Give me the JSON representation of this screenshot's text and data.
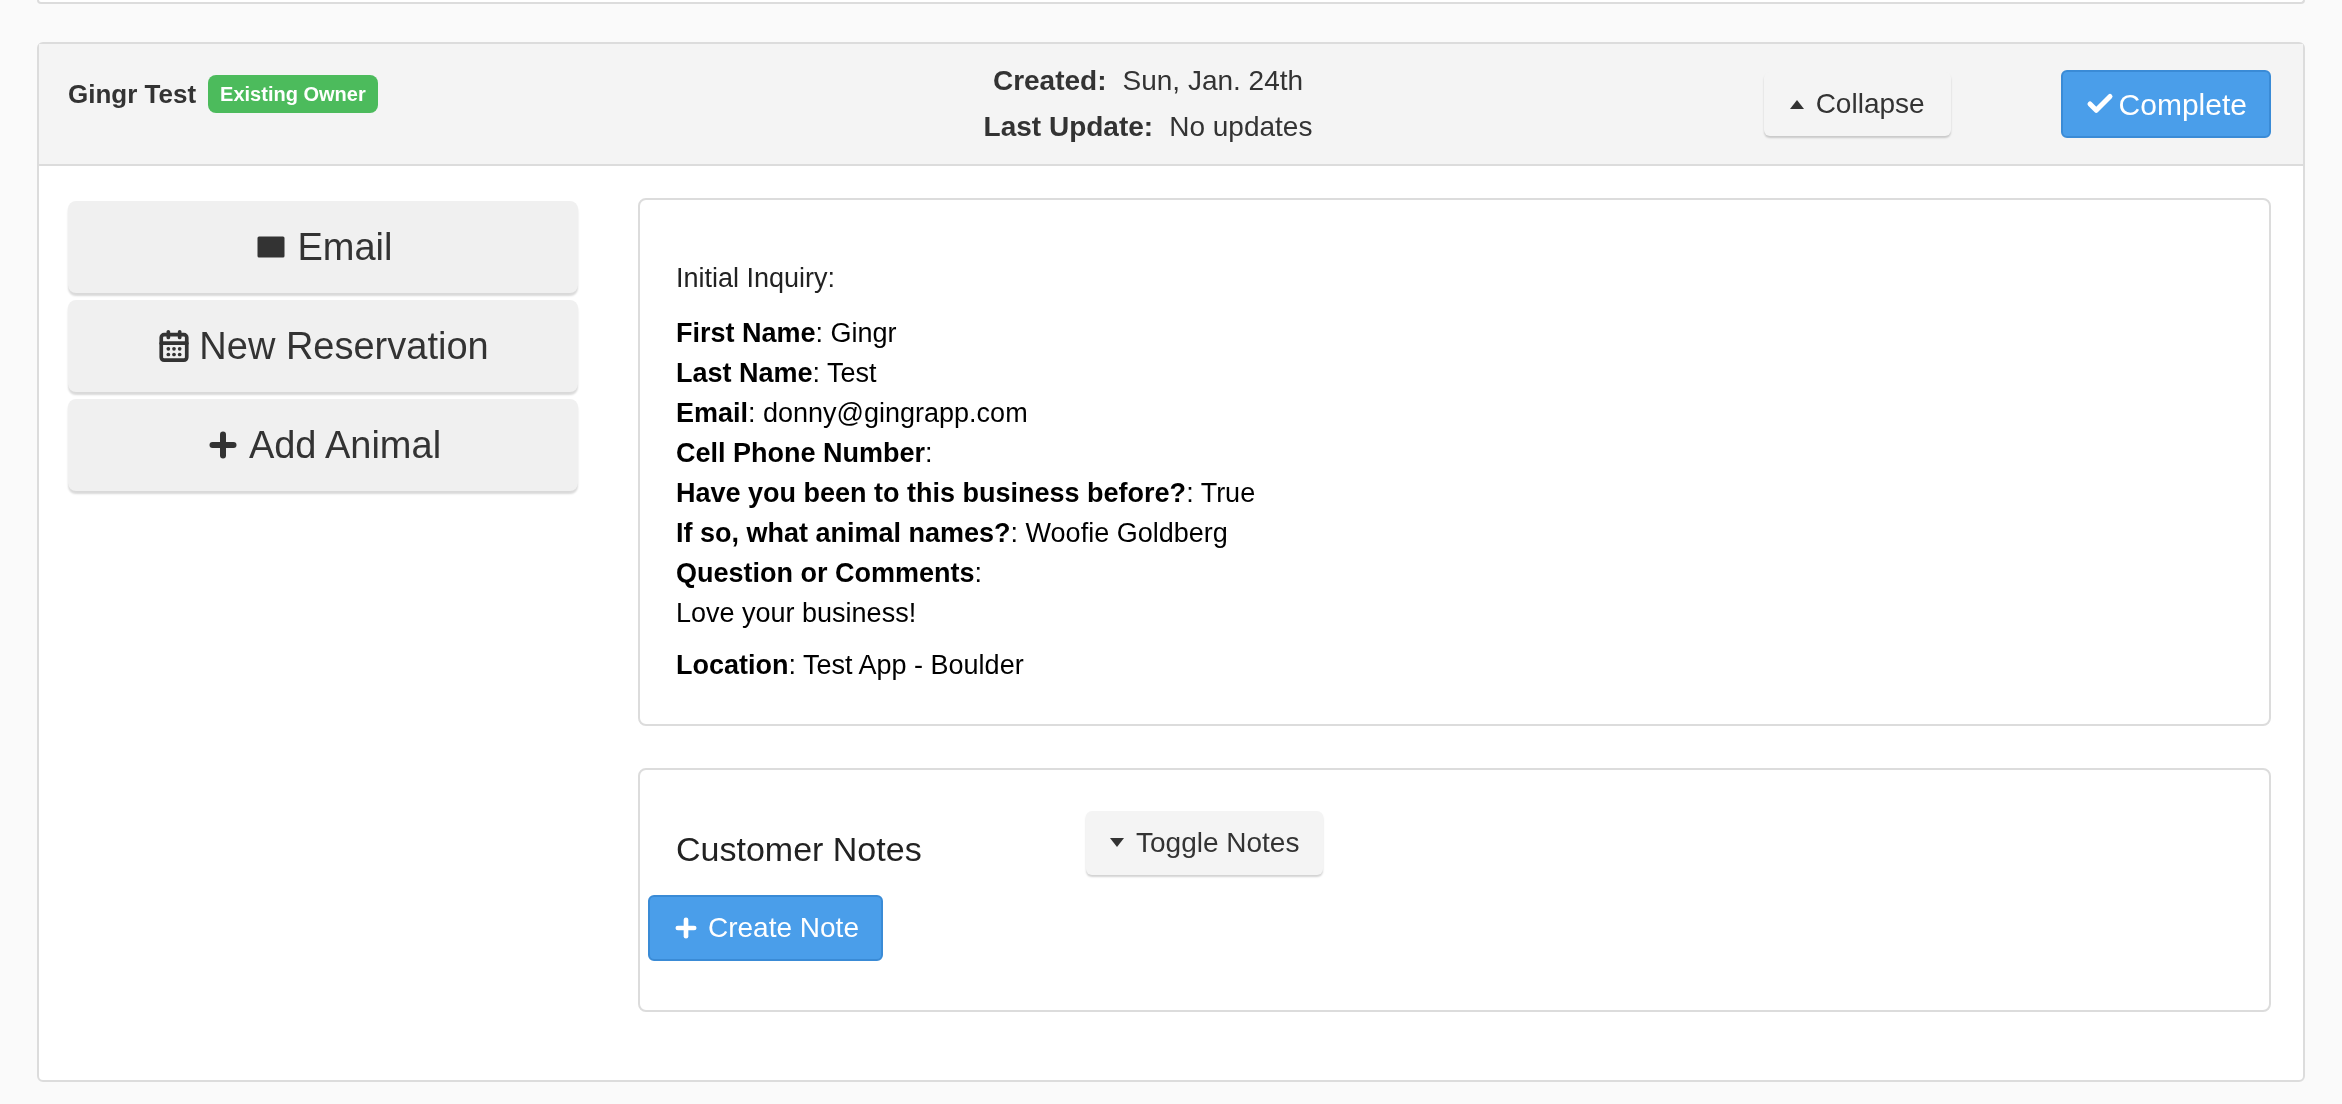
{
  "header": {
    "name": "Gingr Test",
    "badge": "Existing Owner",
    "meta": [
      {
        "label": "Created:",
        "value": "Sun, Jan. 24th"
      },
      {
        "label": "Last Update:",
        "value": "No updates"
      }
    ],
    "collapse_button": "Collapse",
    "complete_button": "Complete"
  },
  "actions": [
    {
      "kind": "email",
      "label": "Email"
    },
    {
      "kind": "reservation",
      "label": "New Reservation"
    },
    {
      "kind": "add",
      "label": "Add Animal"
    }
  ],
  "inquiry": {
    "heading": "Initial Inquiry:",
    "lines": [
      "**First Name**: Gingr",
      "**Last Name**: Test",
      "**Email**: donny@gingrapp.com",
      "**Cell Phone Number**:",
      "**Have you been to this business before?**: True",
      "**If so, what animal names?**: Woofie Goldberg",
      "**Question or Comments**:",
      "Love your business!"
    ],
    "location": "**Location**: Test App - Boulder"
  },
  "notes": {
    "title": "Customer Notes",
    "toggle_button": "Toggle Notes",
    "create_button": "Create Note"
  }
}
